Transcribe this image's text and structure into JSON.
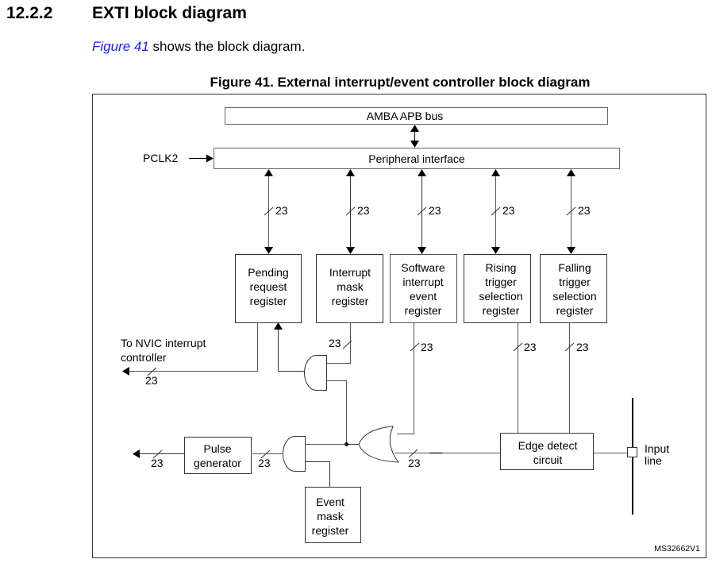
{
  "section": {
    "number": "12.2.2",
    "title": "EXTI block diagram"
  },
  "intro": {
    "link_text": "Figure 41",
    "rest_text": " shows the block diagram."
  },
  "figure": {
    "caption": "Figure 41. External interrupt/event controller block diagram",
    "id_code": "MS32662V1",
    "bus_label": "AMBA APB bus",
    "peripheral_interface_label": "Peripheral interface",
    "clock_label": "PCLK2",
    "bus_width": "23",
    "registers": {
      "pending": [
        "Pending",
        "request",
        "register"
      ],
      "interrupt_mask": [
        "Interrupt",
        "mask",
        "register"
      ],
      "software_interrupt_event": [
        "Software",
        "interrupt",
        "event",
        "register"
      ],
      "rising_trigger": [
        "Rising",
        "trigger",
        "selection",
        "register"
      ],
      "falling_trigger": [
        "Falling",
        "trigger",
        "selection",
        "register"
      ],
      "event_mask": [
        "Event",
        "mask",
        "register"
      ]
    },
    "nvic_label": [
      "To NVIC interrupt",
      "controller"
    ],
    "pulse_generator": [
      "Pulse",
      "generator"
    ],
    "edge_detect": [
      "Edge detect",
      "circuit"
    ],
    "input_line": [
      "Input",
      "line"
    ]
  }
}
